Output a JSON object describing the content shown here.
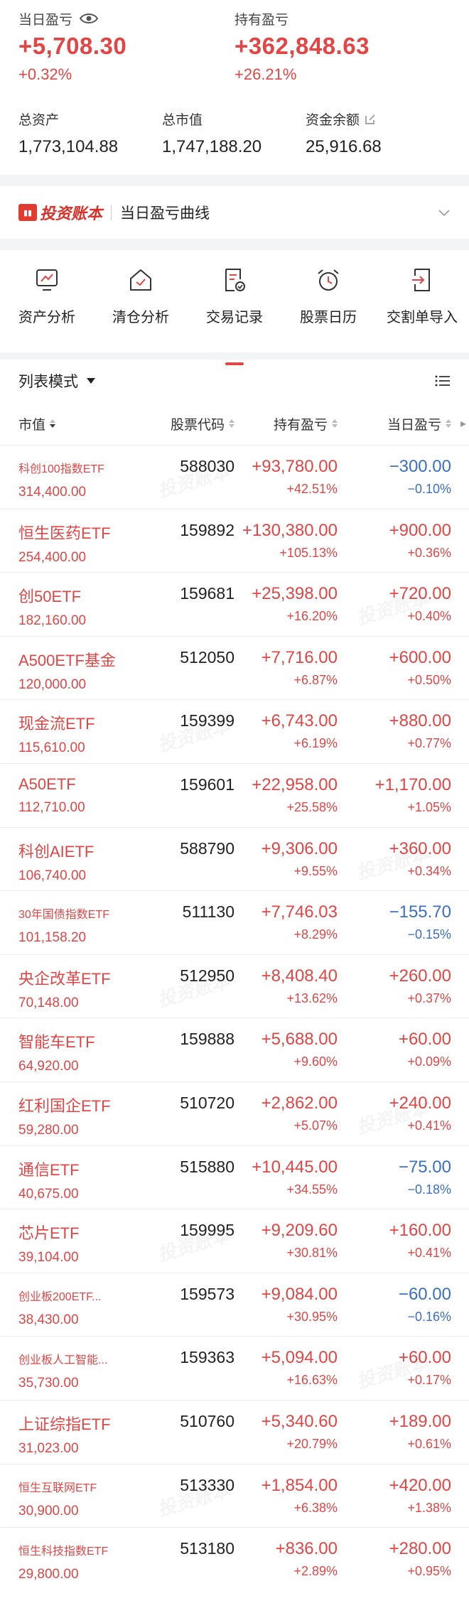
{
  "summary": {
    "today_pl_label": "当日盈亏",
    "today_pl_value": "+5,708.30",
    "today_pl_pct": "+0.32%",
    "hold_pl_label": "持有盈亏",
    "hold_pl_value": "+362,848.63",
    "hold_pl_pct": "+26.21%",
    "total_assets_label": "总资产",
    "total_assets_value": "1,773,104.88",
    "market_value_label": "总市值",
    "market_value_value": "1,747,188.20",
    "cash_label": "资金余额",
    "cash_value": "25,916.68"
  },
  "curve": {
    "logo_text": "投资账本",
    "title": "当日盈亏曲线"
  },
  "tools": [
    {
      "label": "资产分析",
      "icon": "chart-monitor-icon"
    },
    {
      "label": "清仓分析",
      "icon": "house-check-icon"
    },
    {
      "label": "交易记录",
      "icon": "document-check-icon"
    },
    {
      "label": "股票日历",
      "icon": "alarm-clock-icon"
    },
    {
      "label": "交割单导入",
      "icon": "import-arrow-icon"
    }
  ],
  "list": {
    "mode_label": "列表模式",
    "columns": {
      "market_value": "市值",
      "code": "股票代码",
      "hold_pl": "持有盈亏",
      "today_pl": "当日盈亏"
    },
    "watermark": "投资账本",
    "rows": [
      {
        "name": "科创100指数ETF",
        "mv": "314,400.00",
        "code": "588030",
        "pl": "+93,780.00",
        "plp": "+42.51%",
        "tpl": "−300.00",
        "tplp": "−0.10%"
      },
      {
        "name": "恒生医药ETF",
        "mv": "254,400.00",
        "code": "159892",
        "pl": "+130,380.00",
        "plp": "+105.13%",
        "tpl": "+900.00",
        "tplp": "+0.36%"
      },
      {
        "name": "创50ETF",
        "mv": "182,160.00",
        "code": "159681",
        "pl": "+25,398.00",
        "plp": "+16.20%",
        "tpl": "+720.00",
        "tplp": "+0.40%"
      },
      {
        "name": "A500ETF基金",
        "mv": "120,000.00",
        "code": "512050",
        "pl": "+7,716.00",
        "plp": "+6.87%",
        "tpl": "+600.00",
        "tplp": "+0.50%"
      },
      {
        "name": "现金流ETF",
        "mv": "115,610.00",
        "code": "159399",
        "pl": "+6,743.00",
        "plp": "+6.19%",
        "tpl": "+880.00",
        "tplp": "+0.77%"
      },
      {
        "name": "A50ETF",
        "mv": "112,710.00",
        "code": "159601",
        "pl": "+22,958.00",
        "plp": "+25.58%",
        "tpl": "+1,170.00",
        "tplp": "+1.05%"
      },
      {
        "name": "科创AIETF",
        "mv": "106,740.00",
        "code": "588790",
        "pl": "+9,306.00",
        "plp": "+9.55%",
        "tpl": "+360.00",
        "tplp": "+0.34%"
      },
      {
        "name": "30年国债指数ETF",
        "mv": "101,158.20",
        "code": "511130",
        "pl": "+7,746.03",
        "plp": "+8.29%",
        "tpl": "−155.70",
        "tplp": "−0.15%"
      },
      {
        "name": "央企改革ETF",
        "mv": "70,148.00",
        "code": "512950",
        "pl": "+8,408.40",
        "plp": "+13.62%",
        "tpl": "+260.00",
        "tplp": "+0.37%"
      },
      {
        "name": "智能车ETF",
        "mv": "64,920.00",
        "code": "159888",
        "pl": "+5,688.00",
        "plp": "+9.60%",
        "tpl": "+60.00",
        "tplp": "+0.09%"
      },
      {
        "name": "红利国企ETF",
        "mv": "59,280.00",
        "code": "510720",
        "pl": "+2,862.00",
        "plp": "+5.07%",
        "tpl": "+240.00",
        "tplp": "+0.41%"
      },
      {
        "name": "通信ETF",
        "mv": "40,675.00",
        "code": "515880",
        "pl": "+10,445.00",
        "plp": "+34.55%",
        "tpl": "−75.00",
        "tplp": "−0.18%"
      },
      {
        "name": "芯片ETF",
        "mv": "39,104.00",
        "code": "159995",
        "pl": "+9,209.60",
        "plp": "+30.81%",
        "tpl": "+160.00",
        "tplp": "+0.41%"
      },
      {
        "name": "创业板200ETF...",
        "mv": "38,430.00",
        "code": "159573",
        "pl": "+9,084.00",
        "plp": "+30.95%",
        "tpl": "−60.00",
        "tplp": "−0.16%"
      },
      {
        "name": "创业板人工智能...",
        "mv": "35,730.00",
        "code": "159363",
        "pl": "+5,094.00",
        "plp": "+16.63%",
        "tpl": "+60.00",
        "tplp": "+0.17%"
      },
      {
        "name": "上证综指ETF",
        "mv": "31,023.00",
        "code": "510760",
        "pl": "+5,340.60",
        "plp": "+20.79%",
        "tpl": "+189.00",
        "tplp": "+0.61%"
      },
      {
        "name": "恒生互联网ETF",
        "mv": "30,900.00",
        "code": "513330",
        "pl": "+1,854.00",
        "plp": "+6.38%",
        "tpl": "+420.00",
        "tplp": "+1.38%"
      },
      {
        "name": "恒生科技指数ETF",
        "mv": "29,800.00",
        "code": "513180",
        "pl": "+836.00",
        "plp": "+2.89%",
        "tpl": "+280.00",
        "tplp": "+0.95%"
      }
    ]
  }
}
